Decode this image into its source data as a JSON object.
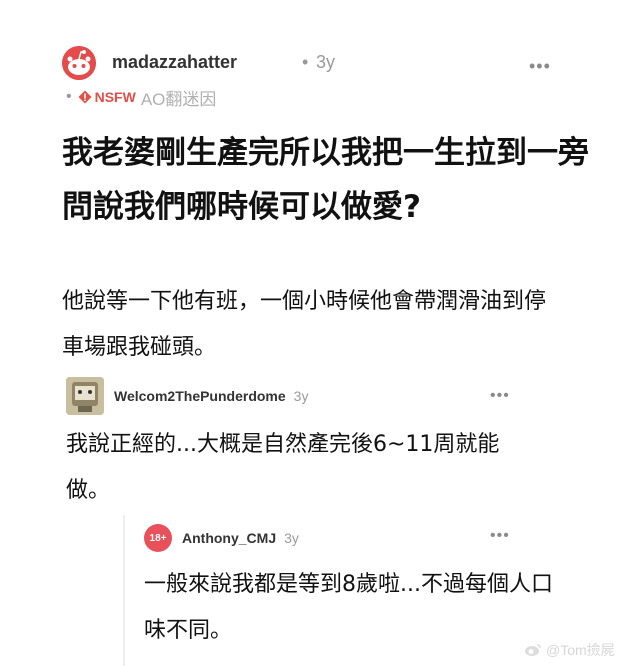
{
  "post": {
    "username": "madazzahatter",
    "dot": "•",
    "time": "3y",
    "flair_dot": "•",
    "nsfw_label": "NSFW",
    "flair": "AO翻迷因",
    "more": "•••",
    "title": "我老婆剛生產完所以我把一生拉到一旁問說我們哪時候可以做愛?",
    "body": "他說等一下他有班，一個小時候他會帶潤滑油到停車場跟我碰頭。"
  },
  "comments": [
    {
      "username": "Welcom2ThePunderdome",
      "time": "3y",
      "more": "•••",
      "body": "我說正經的...大概是自然產完後6~11周就能做。"
    },
    {
      "username": "Anthony_CMJ",
      "avatar_text": "18+",
      "time": "3y",
      "more": "•••",
      "body": "一般來說我都是等到8歲啦...不過每個人口味不同。"
    }
  ],
  "watermark": {
    "text": "@Tom撿屍"
  },
  "colors": {
    "nsfw": "#e44f48",
    "muted": "#9a9a9a",
    "text": "#111111"
  },
  "icons": {
    "op_avatar": "reddit-snoo-icon",
    "nsfw": "nsfw-icon",
    "more": "more-options-icon",
    "watermark": "weibo-icon"
  }
}
